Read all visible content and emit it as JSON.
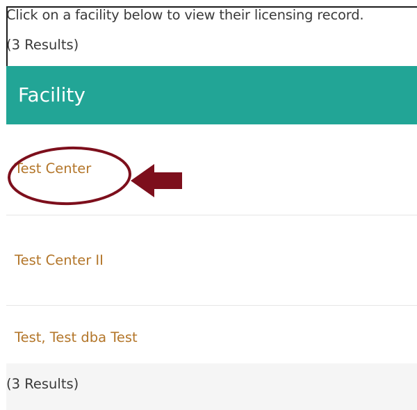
{
  "intro_text": "Click on a facility below to view their licensing record.",
  "results_count_top": "(3 Results)",
  "table": {
    "header": "Facility",
    "rows": [
      {
        "name": "Test Center"
      },
      {
        "name": "Test Center II"
      },
      {
        "name": "Test, Test dba Test"
      }
    ]
  },
  "results_count_bottom": "(3 Results)",
  "colors": {
    "header_bg": "#22a596",
    "link": "#b3762a",
    "annotation": "#7d0f1c"
  },
  "annotation": {
    "shape": "ellipse-and-arrow",
    "target": "Test Center"
  }
}
